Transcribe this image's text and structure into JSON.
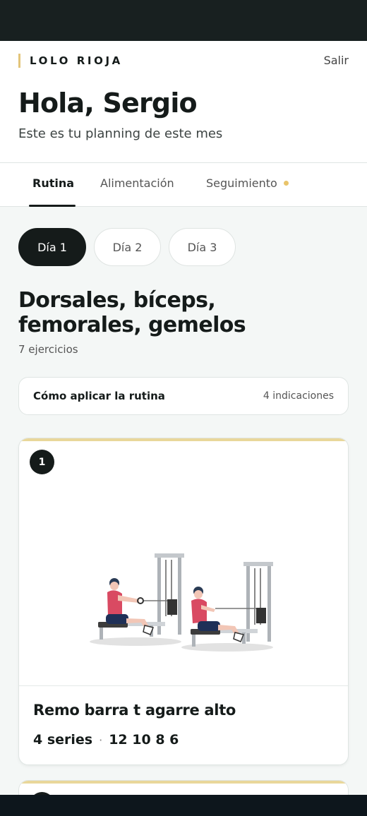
{
  "brand": {
    "name": "LOLO RIOJA",
    "logout": "Salir",
    "accent": "#e3c57a"
  },
  "greeting": "Hola, Sergio",
  "subtitle": "Este es tu planning de este mes",
  "tabs": [
    {
      "label": "Rutina",
      "active": true
    },
    {
      "label": "Alimentación",
      "active": false
    },
    {
      "label": "Seguimiento",
      "active": false,
      "has_notification": true
    }
  ],
  "days": [
    {
      "label": "Día 1",
      "active": true
    },
    {
      "label": "Día 2",
      "active": false
    },
    {
      "label": "Día 3",
      "active": false
    }
  ],
  "routine": {
    "title": "Dorsales, bíceps, femorales, gemelos",
    "count": "7 ejercicios",
    "howto_label": "Cómo aplicar la rutina",
    "howto_count": "4 indicaciones"
  },
  "exercises": [
    {
      "number": "1",
      "name": "Remo barra t agarre alto",
      "sets": "4 series",
      "reps": "12 10 8 6",
      "separator": "·"
    }
  ],
  "icons": {
    "notification_dot": "dot-icon"
  }
}
